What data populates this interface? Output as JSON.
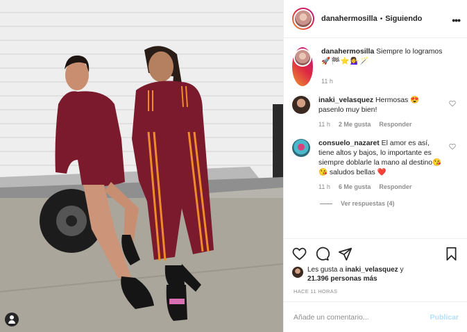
{
  "post": {
    "username": "danahermosilla",
    "separator": "•",
    "follow_state": "Siguiendo",
    "caption_text": "Siempre lo logramos",
    "caption_emojis": "🚀🏁⭐💁‍♀️🪄",
    "caption_time": "11 h"
  },
  "comments": [
    {
      "username": "inaki_velasquez",
      "text": "Hermosas 😍 pasenlo muy bien!",
      "time": "11 h",
      "likes": "2 Me gusta",
      "reply": "Responder"
    },
    {
      "username": "consuelo_nazaret",
      "text": "El amor es así, tiene altos y bajos, lo importante es siempre doblarle la mano al destino😘😘 saludos bellas ❤️",
      "time": "11 h",
      "likes": "6 Me gusta",
      "reply": "Responder",
      "view_replies": "Ver respuestas (4)"
    }
  ],
  "likes_summary": {
    "prefix": "Les gusta a",
    "user": "inaki_velasquez",
    "conj": "y",
    "count": "21.396 personas más"
  },
  "time_ago": "HACE 11 HORAS",
  "add_comment": {
    "placeholder": "Añade un comentario...",
    "publish_label": "Publicar"
  },
  "colors": {
    "outfit": "#7a1a2c",
    "stripe": "#f08a2a",
    "publish": "#b2dffc"
  }
}
